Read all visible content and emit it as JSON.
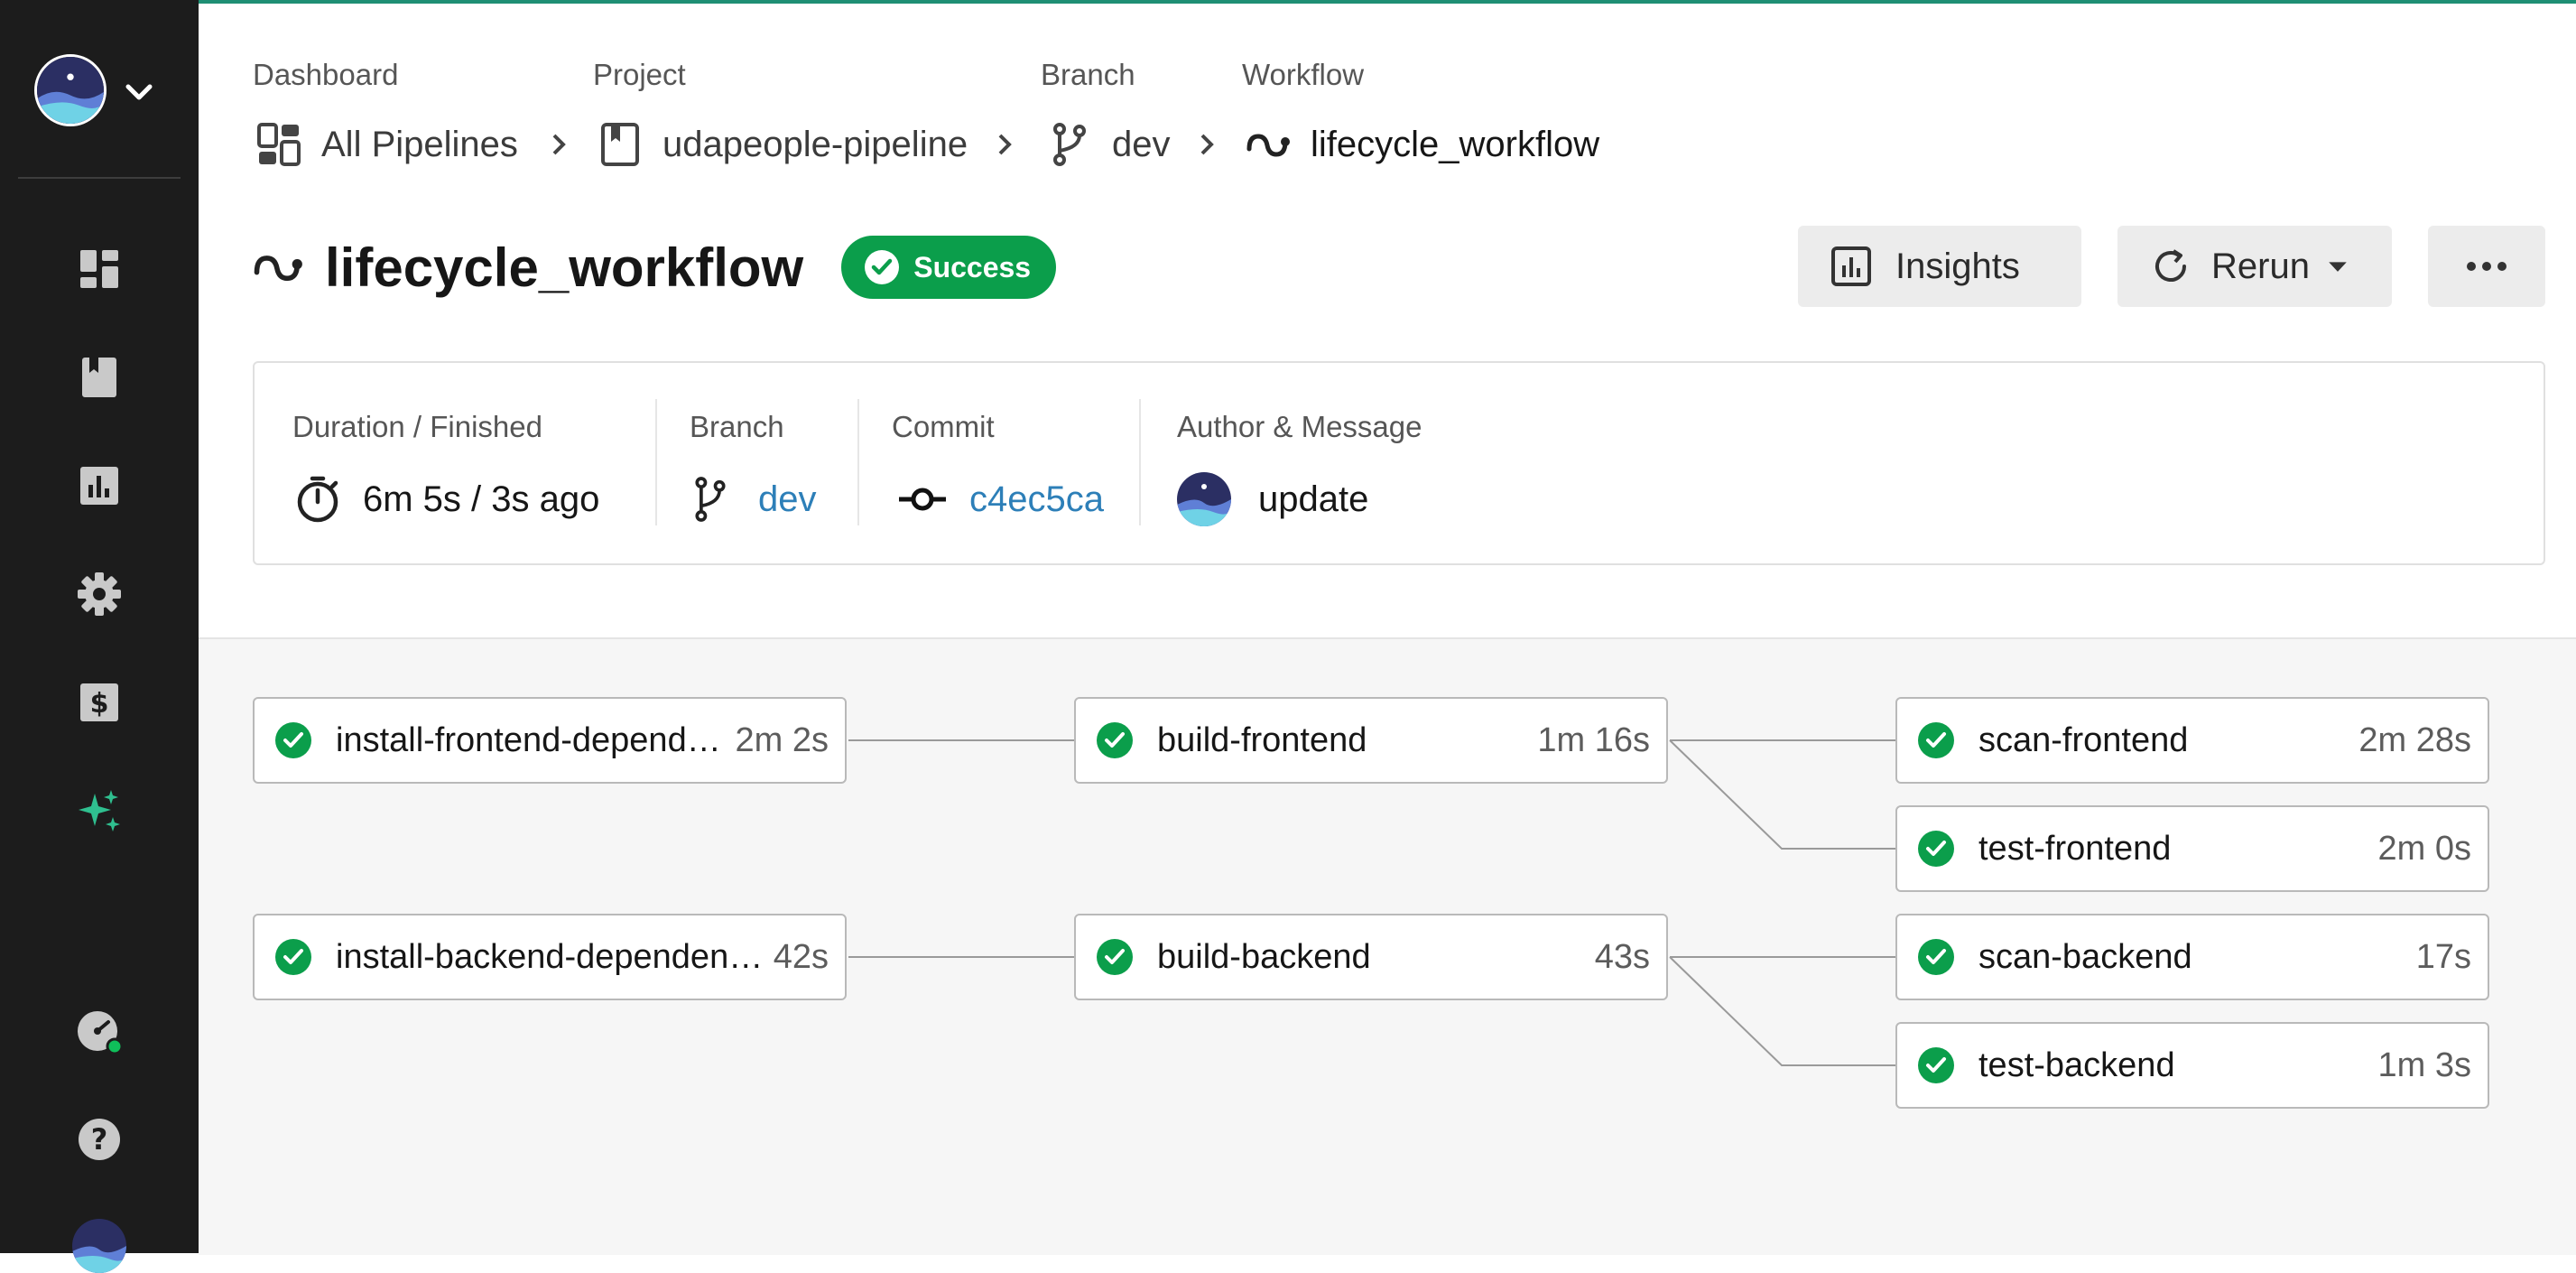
{
  "header": {
    "crumbs": [
      {
        "label": "Dashboard",
        "value": "All Pipelines",
        "icon": "dashboard-icon"
      },
      {
        "label": "Project",
        "value": "udapeople-pipeline",
        "icon": "project-icon"
      },
      {
        "label": "Branch",
        "value": "dev",
        "icon": "branch-icon"
      },
      {
        "label": "Workflow",
        "value": "lifecycle_workflow",
        "icon": "workflow-icon"
      }
    ]
  },
  "workflow": {
    "title": "lifecycle_workflow",
    "status": "Success",
    "status_color": "#0b9e4b"
  },
  "actions": {
    "insights": "Insights",
    "rerun": "Rerun",
    "more": "more-icon"
  },
  "info": {
    "duration_label": "Duration / Finished",
    "duration_value": "6m 5s / 3s ago",
    "branch_label": "Branch",
    "branch_value": "dev",
    "commit_label": "Commit",
    "commit_value": "c4ec5ca",
    "author_label": "Author & Message",
    "message": "update"
  },
  "jobs": [
    {
      "name": "install-frontend-dependencies",
      "duration": "2m 2s",
      "status": "success"
    },
    {
      "name": "build-frontend",
      "duration": "1m 16s",
      "status": "success"
    },
    {
      "name": "scan-frontend",
      "duration": "2m 28s",
      "status": "success"
    },
    {
      "name": "test-frontend",
      "duration": "2m 0s",
      "status": "success"
    },
    {
      "name": "install-backend-dependencies",
      "duration": "42s",
      "status": "success"
    },
    {
      "name": "build-backend",
      "duration": "43s",
      "status": "success"
    },
    {
      "name": "scan-backend",
      "duration": "17s",
      "status": "success"
    },
    {
      "name": "test-backend",
      "duration": "1m 3s",
      "status": "success"
    }
  ],
  "sidebar": {
    "items": [
      "dashboard-icon",
      "projects-icon",
      "insights-icon",
      "settings-icon",
      "plans-icon",
      "ai-sparkle-icon",
      "status-icon",
      "help-icon"
    ],
    "accent": "#1f8f74"
  }
}
